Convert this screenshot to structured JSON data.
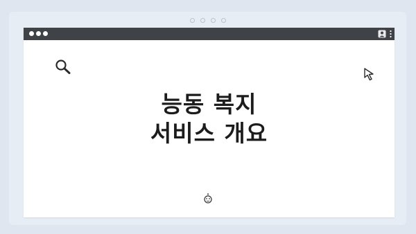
{
  "content": {
    "title_line1": "능동 복지",
    "title_line2": "서비스 개요"
  },
  "icons": {
    "search": "search-icon",
    "cursor": "cursor-icon",
    "user": "user-icon",
    "menu": "menu-icon",
    "face": "face-icon"
  },
  "colors": {
    "background": "#dfe6ef",
    "titlebar": "#3f4347",
    "window": "#ffffff",
    "text": "#1c1c1c"
  }
}
